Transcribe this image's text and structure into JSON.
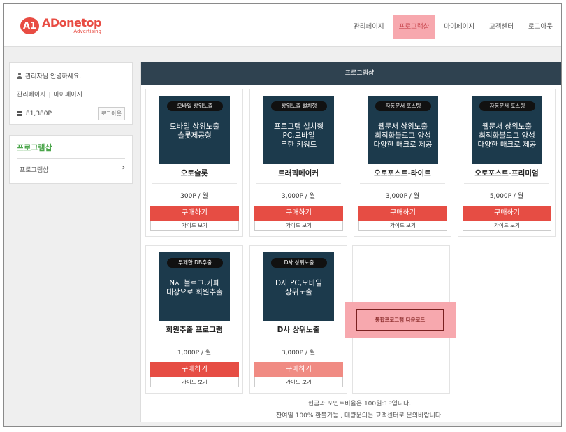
{
  "header": {
    "logo_badge": "A1",
    "logo_main": "ADonetop",
    "logo_sub": "Advertising",
    "nav": [
      "관리페이지",
      "프로그램샵",
      "마이페이지",
      "고객센터",
      "로그아웃"
    ]
  },
  "user": {
    "greeting": "관리자님 안녕하세요.",
    "link_admin": "관리페이지",
    "link_separator": "|",
    "link_mypage": "마이페이지",
    "points": "81,380P",
    "logout": "로그아웃"
  },
  "sidebar": {
    "title": "프로그램샵",
    "item": "프로그램샵",
    "chevron": "›"
  },
  "main": {
    "title": "프로그램샵",
    "products": [
      {
        "tag": "모바일 상위노출",
        "desc": [
          "모바일 상위노출",
          "슬롯제공형"
        ],
        "name": "오토슬롯",
        "price": "300P / 월",
        "buy": "구매하기",
        "guide": "가이드 보기"
      },
      {
        "tag": "상위노출 설치형",
        "desc": [
          "프로그램 설치형",
          "PC,모바일",
          "무한 키워드"
        ],
        "name": "트래픽메이커",
        "price": "3,000P / 월",
        "buy": "구매하기",
        "guide": "가이드 보기"
      },
      {
        "tag": "자동문서 포스팅",
        "desc": [
          "웹문서 상위노출",
          "최적화블로그 양성",
          "다양한 매크로 제공"
        ],
        "name": "오토포스트-라이트",
        "price": "3,000P / 월",
        "buy": "구매하기",
        "guide": "가이드 보기"
      },
      {
        "tag": "자동문서 포스팅",
        "desc": [
          "웹문서 상위노출",
          "최적화블로그 양성",
          "다양한 매크로 제공"
        ],
        "name": "오토포스트-프리미엄",
        "price": "5,000P / 월",
        "buy": "구매하기",
        "guide": "가이드 보기"
      },
      {
        "tag": "무제한 DB추출",
        "desc": [
          "N사 블로그,카페",
          "대상으로 회원추출"
        ],
        "name": "회원추출 프로그램",
        "price": "1,000P / 월",
        "buy": "구매하기",
        "guide": "가이드 보기"
      },
      {
        "tag": "D사 상위노출",
        "desc": [
          "D사 PC,모바일",
          "상위노출"
        ],
        "name": "D사 상위노출",
        "price": "3,000P / 월",
        "buy": "구매하기",
        "guide": "가이드 보기"
      }
    ],
    "download": "통합프로그램 다운로드",
    "notes": [
      "현금과 포인트비율은 100원:1P입니다.",
      "잔여일 100% 환불가능 , 대량문의는 고객센터로 문의바랍니다."
    ]
  },
  "colors": {
    "accent": "#e84c43",
    "nav_active_bg": "#f7a8ae",
    "title_bar": "#2f4250",
    "card_image": "#1c3a4c",
    "buy": "#e64d44",
    "sidebar_title": "#4aa54a"
  }
}
